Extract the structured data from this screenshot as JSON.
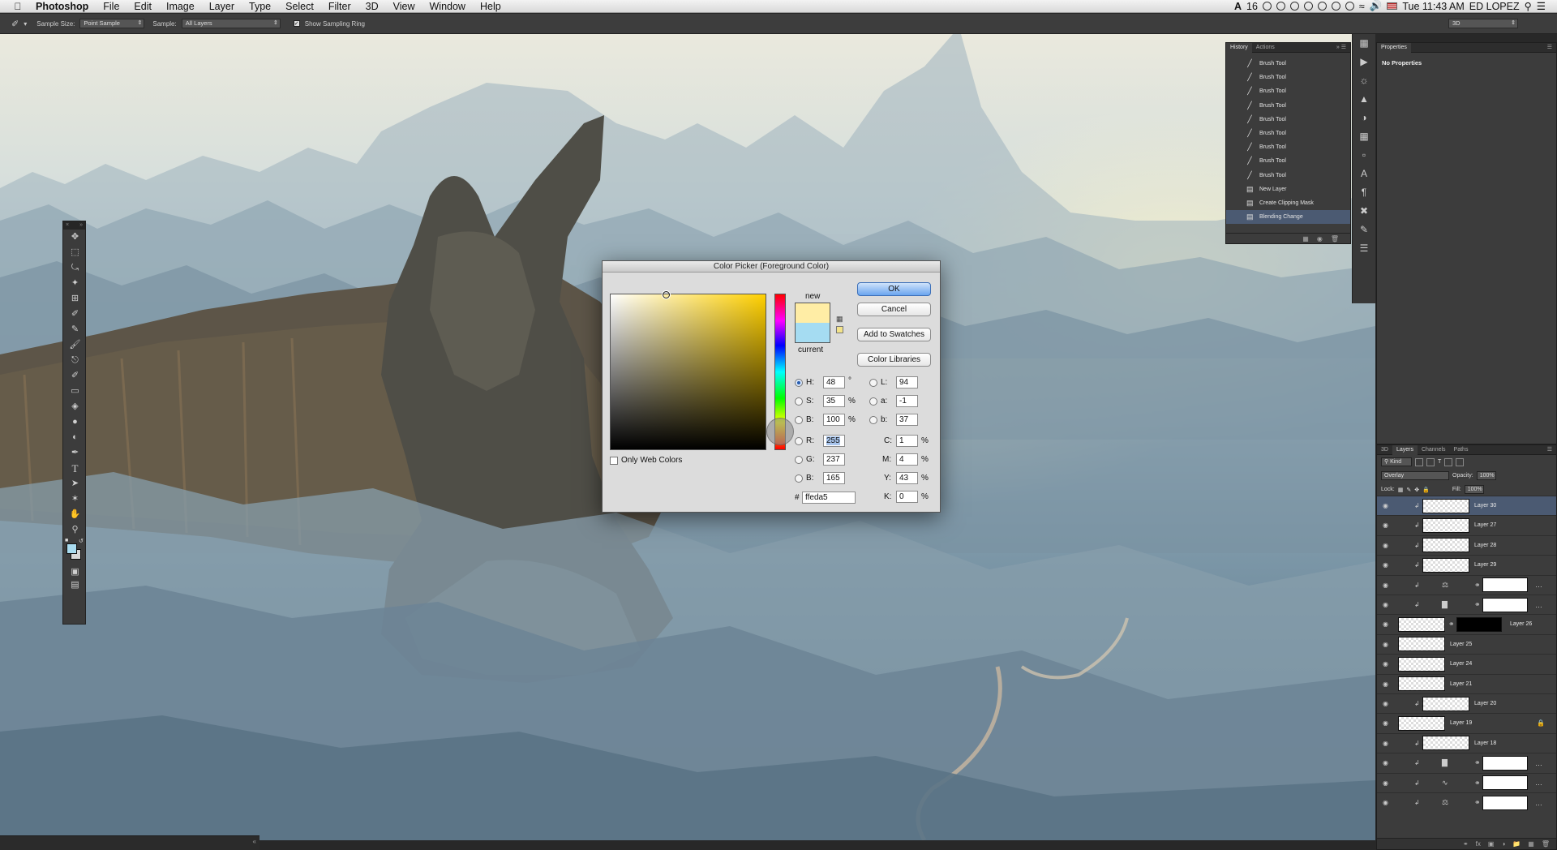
{
  "menubar": {
    "app": "Photoshop",
    "items": [
      "File",
      "Edit",
      "Image",
      "Layer",
      "Type",
      "Select",
      "Filter",
      "3D",
      "View",
      "Window",
      "Help"
    ],
    "adobe_count": "16",
    "clock": "Tue 11:43 AM",
    "user": "ED LOPEZ"
  },
  "options": {
    "sample_size_label": "Sample Size:",
    "sample_size_value": "Point Sample",
    "sample_label": "Sample:",
    "sample_value": "All Layers",
    "sampling_ring": "Show Sampling Ring",
    "workspace": "3D"
  },
  "history": {
    "tabs": [
      "History",
      "Actions"
    ],
    "items": [
      {
        "icon": "brush",
        "label": "Brush Tool"
      },
      {
        "icon": "brush",
        "label": "Brush Tool"
      },
      {
        "icon": "brush",
        "label": "Brush Tool"
      },
      {
        "icon": "brush",
        "label": "Brush Tool"
      },
      {
        "icon": "brush",
        "label": "Brush Tool"
      },
      {
        "icon": "brush",
        "label": "Brush Tool"
      },
      {
        "icon": "brush",
        "label": "Brush Tool"
      },
      {
        "icon": "brush",
        "label": "Brush Tool"
      },
      {
        "icon": "brush",
        "label": "Brush Tool"
      },
      {
        "icon": "doc",
        "label": "New Layer"
      },
      {
        "icon": "doc",
        "label": "Create Clipping Mask"
      },
      {
        "icon": "doc",
        "label": "Blending Change"
      }
    ],
    "selected_index": 11
  },
  "properties": {
    "tab": "Properties",
    "empty": "No Properties"
  },
  "layers_panel": {
    "tabs": [
      "3D",
      "Layers",
      "Channels",
      "Paths"
    ],
    "filter": "Kind",
    "blend_mode": "Overlay",
    "opacity_label": "Opacity:",
    "opacity": "100%",
    "lock_label": "Lock:",
    "fill_label": "Fill:",
    "fill": "100%",
    "layers": [
      {
        "name": "Layer 30",
        "type": "pixel",
        "clipped": true,
        "selected": true
      },
      {
        "name": "Layer 27",
        "type": "pixel",
        "clipped": true
      },
      {
        "name": "Layer 28",
        "type": "pixel",
        "clipped": true
      },
      {
        "name": "Layer 29",
        "type": "pixel",
        "clipped": true
      },
      {
        "name": "",
        "type": "adjustment",
        "icon": "balance-icon",
        "clipped": true
      },
      {
        "name": "",
        "type": "adjustment",
        "icon": "levels-icon",
        "clipped": true
      },
      {
        "name": "Layer 26",
        "type": "masked"
      },
      {
        "name": "Layer 25",
        "type": "pixel"
      },
      {
        "name": "Layer 24",
        "type": "pixel"
      },
      {
        "name": "Layer 21",
        "type": "pixel"
      },
      {
        "name": "Layer 20",
        "type": "pixel",
        "clipped": true
      },
      {
        "name": "Layer 19",
        "type": "pixel",
        "locked": true
      },
      {
        "name": "Layer 18",
        "type": "pixel",
        "clipped": true
      },
      {
        "name": "",
        "type": "adjustment",
        "icon": "levels-icon",
        "clipped": true
      },
      {
        "name": "",
        "type": "adjustment",
        "icon": "curves-icon",
        "clipped": true
      },
      {
        "name": "",
        "type": "adjustment",
        "icon": "balance-icon",
        "clipped": true
      }
    ]
  },
  "color_picker": {
    "title": "Color Picker (Foreground Color)",
    "new_label": "new",
    "current_label": "current",
    "new_color": "#ffeda5",
    "current_color": "#a5dcf2",
    "buttons": {
      "ok": "OK",
      "cancel": "Cancel",
      "add_swatches": "Add to Swatches",
      "libraries": "Color Libraries"
    },
    "hsb": {
      "h": "48",
      "s": "35",
      "b": "100"
    },
    "rgb": {
      "r": "255",
      "g": "237",
      "b": "165"
    },
    "lab": {
      "l": "94",
      "a": "-1",
      "b": "37"
    },
    "cmyk": {
      "c": "1",
      "m": "4",
      "y": "43",
      "k": "0"
    },
    "hex": "ffeda5",
    "only_web": "Only Web Colors",
    "labels": {
      "H": "H:",
      "S": "S:",
      "B": "B:",
      "R": "R:",
      "G": "G:",
      "Bl": "B:",
      "L": "L:",
      "a": "a:",
      "b": "b:",
      "C": "C:",
      "M": "M:",
      "Y": "Y:",
      "K": "K:",
      "hash": "#"
    },
    "units": {
      "deg": "°",
      "pct": "%"
    }
  }
}
